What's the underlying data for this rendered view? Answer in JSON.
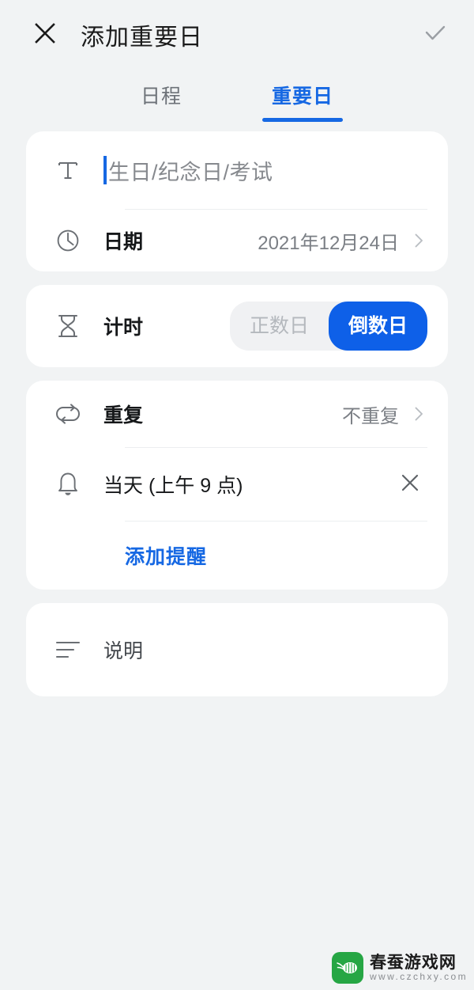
{
  "header": {
    "close_icon": "close-x-icon",
    "title": "添加重要日",
    "confirm_icon": "check-icon"
  },
  "tabs": [
    {
      "label": "日程",
      "active": false
    },
    {
      "label": "重要日",
      "active": true
    }
  ],
  "colors": {
    "accent_blue": "#1668e3",
    "segment_active_blue": "#0e60e8",
    "page_background": "#f1f3f4",
    "card_background": "#ffffff",
    "muted_text": "#7b7f85",
    "watermark_green": "#26a644"
  },
  "cards": {
    "details": {
      "title_row": {
        "icon": "text-format-t-icon",
        "placeholder": "生日/纪念日/考试",
        "value": "",
        "caret_visible": true
      },
      "date_row": {
        "icon": "clock-icon",
        "label": "日期",
        "value": "2021年12月24日",
        "chevron": "chevron-right-icon"
      }
    },
    "timing": {
      "icon": "hourglass-icon",
      "label": "计时",
      "options": [
        {
          "label": "正数日",
          "active": false
        },
        {
          "label": "倒数日",
          "active": true
        }
      ]
    },
    "repeat_reminder": {
      "repeat_row": {
        "icon": "repeat-loop-icon",
        "label": "重复",
        "value": "不重复",
        "chevron": "chevron-right-icon"
      },
      "reminder_row": {
        "icon": "bell-icon",
        "label": "当天 (上午 9 点)",
        "clear_icon": "close-x-icon"
      },
      "add_reminder_label": "添加提醒"
    },
    "description": {
      "icon": "text-lines-icon",
      "label": "说明"
    }
  },
  "watermark": {
    "icon": "silkworm-logo-icon",
    "name": "春蚕游戏网",
    "url": "www.czchxy.com"
  }
}
